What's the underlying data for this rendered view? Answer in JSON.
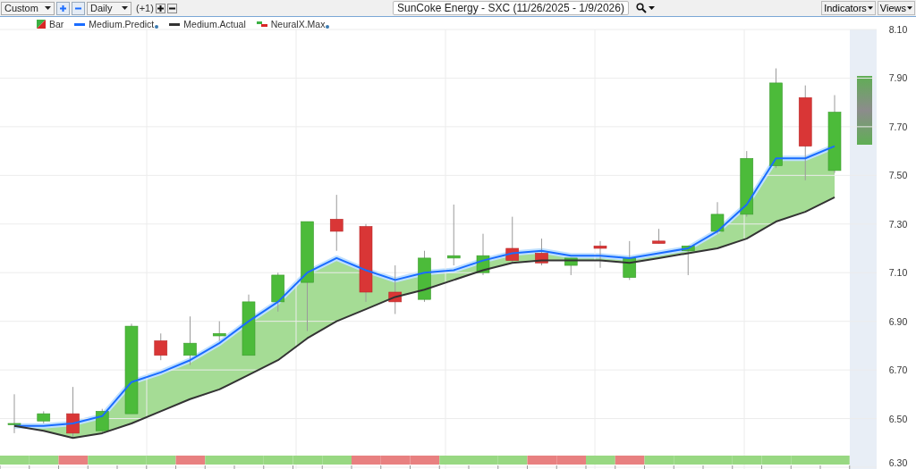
{
  "toolbar": {
    "range_select": {
      "value": "Custom"
    },
    "period_select": {
      "value": "Daily"
    },
    "offset": "(+1)",
    "title": "SunCoke Energy - SXC (11/26/2025 - 1/9/2026)",
    "buttons": [
      "Indicators",
      "Views"
    ]
  },
  "legend": [
    {
      "kind": "bar",
      "label": "Bar",
      "dot": false
    },
    {
      "kind": "series",
      "dot": true
    },
    {
      "kind": "series",
      "dot": false
    },
    {
      "kind": "neural",
      "label": "NeuralX.Max",
      "dot": true
    }
  ],
  "chart": {
    "chart_data": {
      "type": "candlestick",
      "grid": true,
      "ylim": [
        6.3,
        8.1
      ],
      "yticks": [
        {
          "value": 8.1,
          "label": "8.10"
        },
        {
          "value": 7.9,
          "label": "7.90"
        },
        {
          "value": 7.7,
          "label": "7.70"
        },
        {
          "value": 7.5,
          "label": "7.50"
        },
        {
          "value": 7.3,
          "label": "7.30"
        },
        {
          "value": 7.1,
          "label": "7.10"
        },
        {
          "value": 6.9,
          "label": "6.90"
        },
        {
          "value": 6.7,
          "label": "6.70"
        },
        {
          "value": 6.5,
          "label": "6.50"
        },
        {
          "value": 6.3,
          "label": "6.30"
        }
      ],
      "series": [
        {
          "name": "Medium.Predict",
          "type": "line",
          "color": "#1a6cff",
          "values": [
            6.47,
            6.47,
            6.48,
            6.51,
            6.65,
            6.69,
            6.74,
            6.81,
            6.9,
            6.98,
            7.1,
            7.16,
            7.11,
            7.07,
            7.1,
            7.11,
            7.15,
            7.18,
            7.19,
            7.17,
            7.17,
            7.16,
            7.18,
            7.2,
            7.27,
            7.38,
            7.57,
            7.57,
            7.62
          ]
        },
        {
          "name": "Medium.Actual",
          "type": "line",
          "color": "#333333",
          "values": [
            6.47,
            6.45,
            6.42,
            6.44,
            6.48,
            6.53,
            6.58,
            6.62,
            6.68,
            6.74,
            6.83,
            6.9,
            6.95,
            7.0,
            7.03,
            7.07,
            7.11,
            7.14,
            7.15,
            7.15,
            7.15,
            7.14,
            7.16,
            7.18,
            7.2,
            7.24,
            7.31,
            7.35,
            7.41
          ]
        }
      ],
      "ohlc": [
        [
          6.48,
          6.6,
          6.44,
          6.48
        ],
        [
          6.49,
          6.53,
          6.48,
          6.52
        ],
        [
          6.52,
          6.63,
          6.42,
          6.44
        ],
        [
          6.45,
          6.54,
          6.44,
          6.53
        ],
        [
          6.52,
          6.89,
          6.52,
          6.88
        ],
        [
          6.82,
          6.85,
          6.74,
          6.76
        ],
        [
          6.76,
          6.92,
          6.72,
          6.81
        ],
        [
          6.84,
          6.9,
          6.82,
          6.85
        ],
        [
          6.76,
          7.01,
          6.76,
          6.98
        ],
        [
          6.98,
          7.1,
          6.94,
          7.09
        ],
        [
          7.06,
          7.31,
          6.86,
          7.31
        ],
        [
          7.32,
          7.42,
          7.19,
          7.27
        ],
        [
          7.29,
          7.3,
          6.98,
          7.02
        ],
        [
          7.02,
          7.13,
          6.93,
          6.98
        ],
        [
          6.99,
          7.19,
          6.98,
          7.16
        ],
        [
          7.16,
          7.38,
          7.13,
          7.17
        ],
        [
          7.1,
          7.26,
          7.09,
          7.17
        ],
        [
          7.2,
          7.33,
          7.14,
          7.15
        ],
        [
          7.18,
          7.24,
          7.13,
          7.14
        ],
        [
          7.13,
          7.16,
          7.09,
          7.16
        ],
        [
          7.21,
          7.23,
          7.12,
          7.2
        ],
        [
          7.08,
          7.23,
          7.07,
          7.16
        ],
        [
          7.23,
          7.28,
          7.22,
          7.22
        ],
        [
          7.19,
          7.21,
          7.09,
          7.21
        ],
        [
          7.27,
          7.39,
          7.26,
          7.34
        ],
        [
          7.34,
          7.6,
          7.33,
          7.57
        ],
        [
          7.54,
          7.94,
          7.53,
          7.88
        ],
        [
          7.82,
          7.87,
          7.48,
          7.62
        ],
        [
          7.52,
          7.83,
          7.51,
          7.76
        ]
      ]
    },
    "signal_strip": [
      {
        "color": "#98d882"
      },
      {
        "color": "#98d882"
      },
      {
        "color": "#e88080"
      },
      {
        "color": "#98d882"
      },
      {
        "color": "#98d882"
      },
      {
        "color": "#98d882"
      },
      {
        "color": "#e88080"
      },
      {
        "color": "#98d882"
      },
      {
        "color": "#98d882"
      },
      {
        "color": "#98d882"
      },
      {
        "color": "#98d882"
      },
      {
        "color": "#98d882"
      },
      {
        "color": "#e88080"
      },
      {
        "color": "#e88080"
      },
      {
        "color": "#e88080"
      },
      {
        "color": "#98d882"
      },
      {
        "color": "#98d882"
      },
      {
        "color": "#98d882"
      },
      {
        "color": "#e88080"
      },
      {
        "color": "#e88080"
      },
      {
        "color": "#98d882"
      },
      {
        "color": "#e88080"
      },
      {
        "color": "#98d882"
      },
      {
        "color": "#98d882"
      },
      {
        "color": "#98d882"
      },
      {
        "color": "#98d882"
      },
      {
        "color": "#98d882"
      },
      {
        "color": "#98d882"
      },
      {
        "color": "#98d882"
      }
    ]
  }
}
